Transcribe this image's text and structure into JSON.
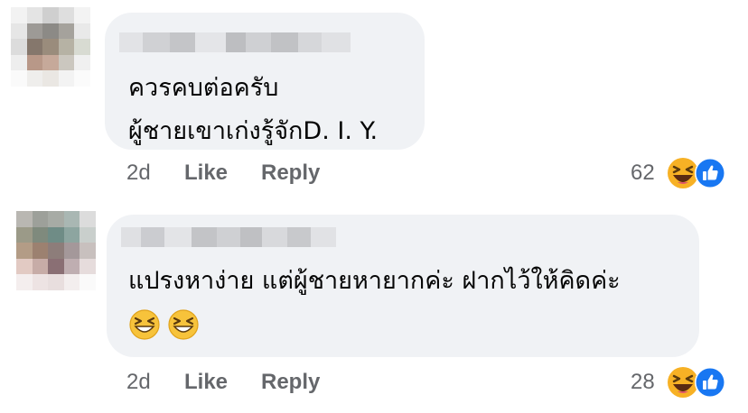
{
  "comments": [
    {
      "author_hidden": true,
      "text_lines": [
        "ควรคบต่อครับ",
        "ผู้ชายเขาเก่งรู้จักD. I. Y."
      ],
      "timestamp": "2d",
      "like_label": "Like",
      "reply_label": "Reply",
      "reaction_count": "62",
      "reactions": [
        "laugh-emoji",
        "like-thumb"
      ]
    },
    {
      "author_hidden": true,
      "text_lines": [
        "แปรงหาง่าย แต่ผู้ชายหายากค่ะ ฝากไว้ให้คิดค่ะ"
      ],
      "inline_emojis": [
        "grinning-squinting-emoji",
        "grinning-squinting-emoji"
      ],
      "timestamp": "2d",
      "like_label": "Like",
      "reply_label": "Reply",
      "reaction_count": "28",
      "reactions": [
        "laugh-emoji",
        "like-thumb"
      ]
    }
  ],
  "colors": {
    "bubble_bg": "#f0f2f5",
    "meta_text": "#65676b",
    "like_blue": "#1877f2",
    "emoji_yellow": "#f7b125"
  }
}
